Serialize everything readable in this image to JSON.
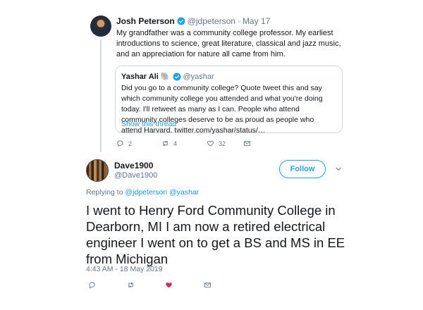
{
  "parent_tweet": {
    "author_name": "Josh Peterson",
    "handle": "@jdpeterson",
    "separator": "·",
    "date": "May 17",
    "text": "My grandfather was a community college professor. My earliest introductions to science, great literature, classical and jazz music, and an appreciation for nature all came from him.",
    "quote": {
      "author_name": "Yashar Ali",
      "emoji": "🐘",
      "handle": "@yashar",
      "text": "Did you go to a community college? Quote tweet this and say which community college you attended and what you're doing today. I'll retweet as many as I can. People who attend community colleges deserve to be as proud as people who attend Harvard. twitter.com/yashar/status/…",
      "show_thread": "Show this thread"
    },
    "actions": {
      "replies": "2",
      "retweets": "4",
      "likes": "32"
    }
  },
  "reply_tweet": {
    "author_name": "Dave1900",
    "handle": "@Dave1900",
    "follow_label": "Follow",
    "replying_prefix": "Replying to",
    "mention_1": "@jdpeterson",
    "mention_2": "@yashar",
    "text": "I went to Henry Ford Community College in Dearborn, MI  I am now a retired electrical engineer  I went on to get a BS and MS in EE from Michigan",
    "timestamp": "4:43 AM - 18 May 2019"
  },
  "colors": {
    "accent": "#1da1f2",
    "link": "#1b95e0",
    "muted": "#657786",
    "like": "#e0245e"
  }
}
